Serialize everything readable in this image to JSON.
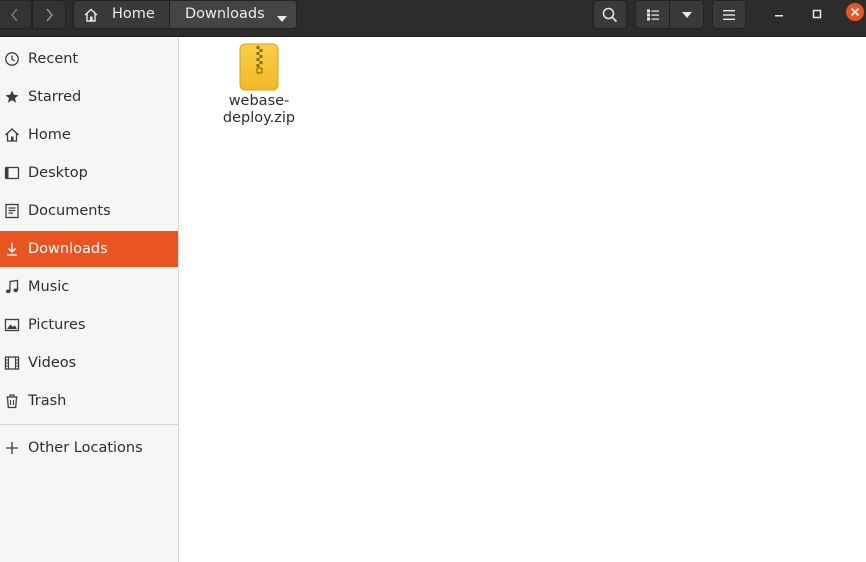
{
  "window": {
    "accent_color": "#e95420",
    "header_color": "#2c2c2c"
  },
  "pathbar": {
    "home_label": "Home",
    "current_label": "Downloads"
  },
  "toolbar": {
    "back_icon": "chevron-left-icon",
    "forward_icon": "chevron-right-icon",
    "search_icon": "search-icon",
    "view_icon": "list-view-icon",
    "view_menu_icon": "chevron-down-icon",
    "menu_icon": "hamburger-icon"
  },
  "sidebar": {
    "items": [
      {
        "label": "Recent",
        "icon": "clock-icon"
      },
      {
        "label": "Starred",
        "icon": "star-icon"
      },
      {
        "label": "Home",
        "icon": "home-icon"
      },
      {
        "label": "Desktop",
        "icon": "desktop-icon"
      },
      {
        "label": "Documents",
        "icon": "document-icon"
      },
      {
        "label": "Downloads",
        "icon": "download-icon",
        "active": true
      },
      {
        "label": "Music",
        "icon": "music-icon"
      },
      {
        "label": "Pictures",
        "icon": "picture-icon"
      },
      {
        "label": "Videos",
        "icon": "video-icon"
      },
      {
        "label": "Trash",
        "icon": "trash-icon"
      }
    ],
    "other_locations": {
      "label": "Other Locations",
      "icon": "plus-icon"
    }
  },
  "files": [
    {
      "name_line1": "webase-",
      "name_line2": "deploy.zip",
      "icon": "zip-archive-icon"
    }
  ]
}
